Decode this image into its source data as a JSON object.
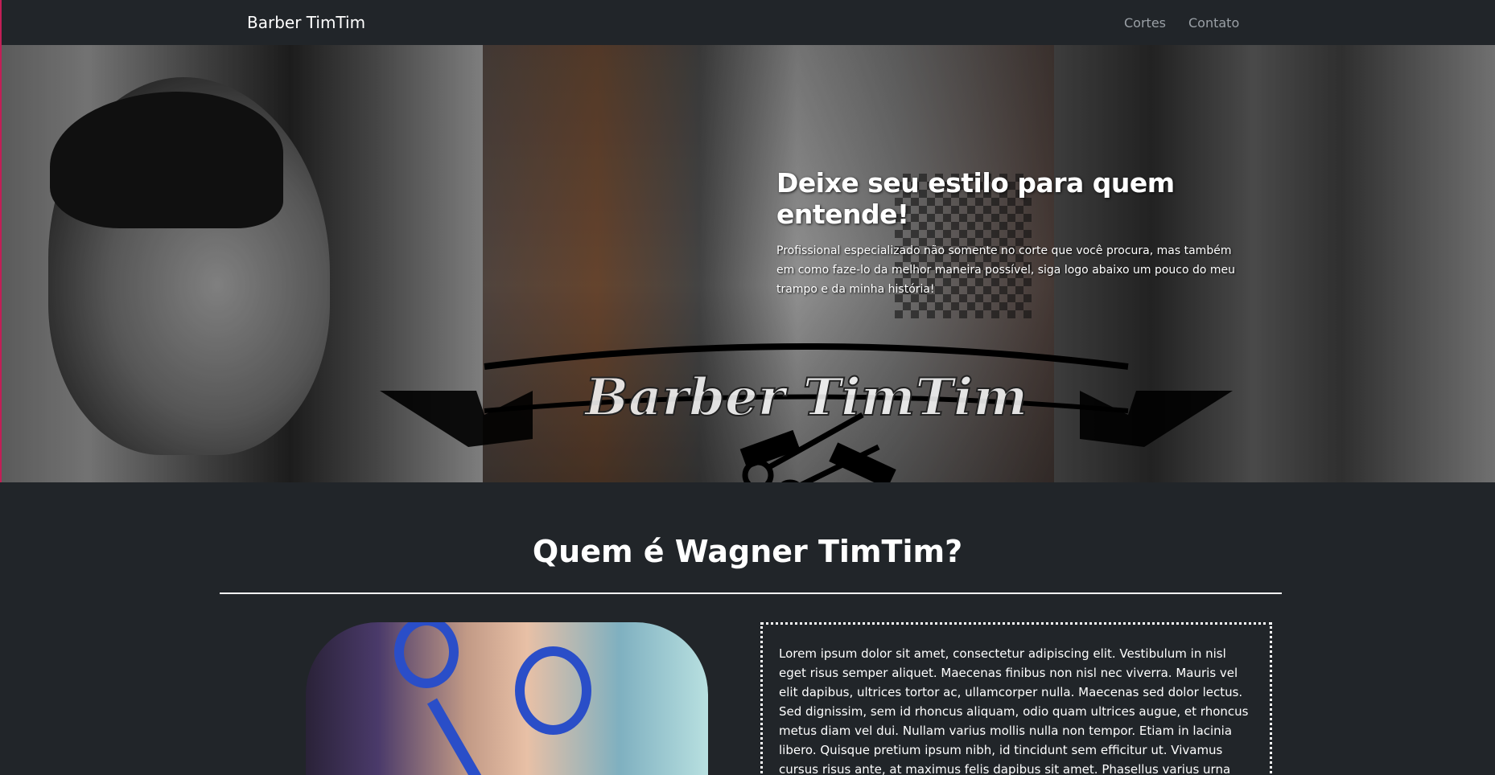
{
  "navbar": {
    "brand": "Barber TimTim",
    "links": [
      {
        "label": "Cortes"
      },
      {
        "label": "Contato"
      }
    ]
  },
  "hero": {
    "title": "Deixe seu estilo para quem entende!",
    "text": "Profissional especializado não somente no corte que você procura, mas também em como faze-lo da melhor maneira possível, siga logo abaixo um pouco do meu trampo e da minha história!",
    "logo_text": "Barber TimTim"
  },
  "about": {
    "title": "Quem é Wagner TimTim?",
    "text": "Lorem ipsum dolor sit amet, consectetur adipiscing elit. Vestibulum in nisl eget risus semper aliquet. Maecenas finibus non nisl nec viverra. Mauris vel elit dapibus, ultrices tortor ac, ullamcorper nulla. Maecenas sed dolor lectus. Sed dignissim, sem id rhoncus aliquam, odio quam ultrices augue, et rhoncus metus diam vel dui. Nullam varius mollis nulla non tempor. Etiam in lacinia libero. Quisque pretium ipsum nibh, id tincidunt sem efficitur ut. Vivamus cursus risus ante, at maximus felis dapibus sit amet. Phasellus varius urna nec risus molestie tincidunt. Integer purus"
  },
  "colors": {
    "background": "#212529",
    "text": "#ffffff",
    "nav_link": "#9aa0a6",
    "accent_edge": "#c21e56"
  }
}
